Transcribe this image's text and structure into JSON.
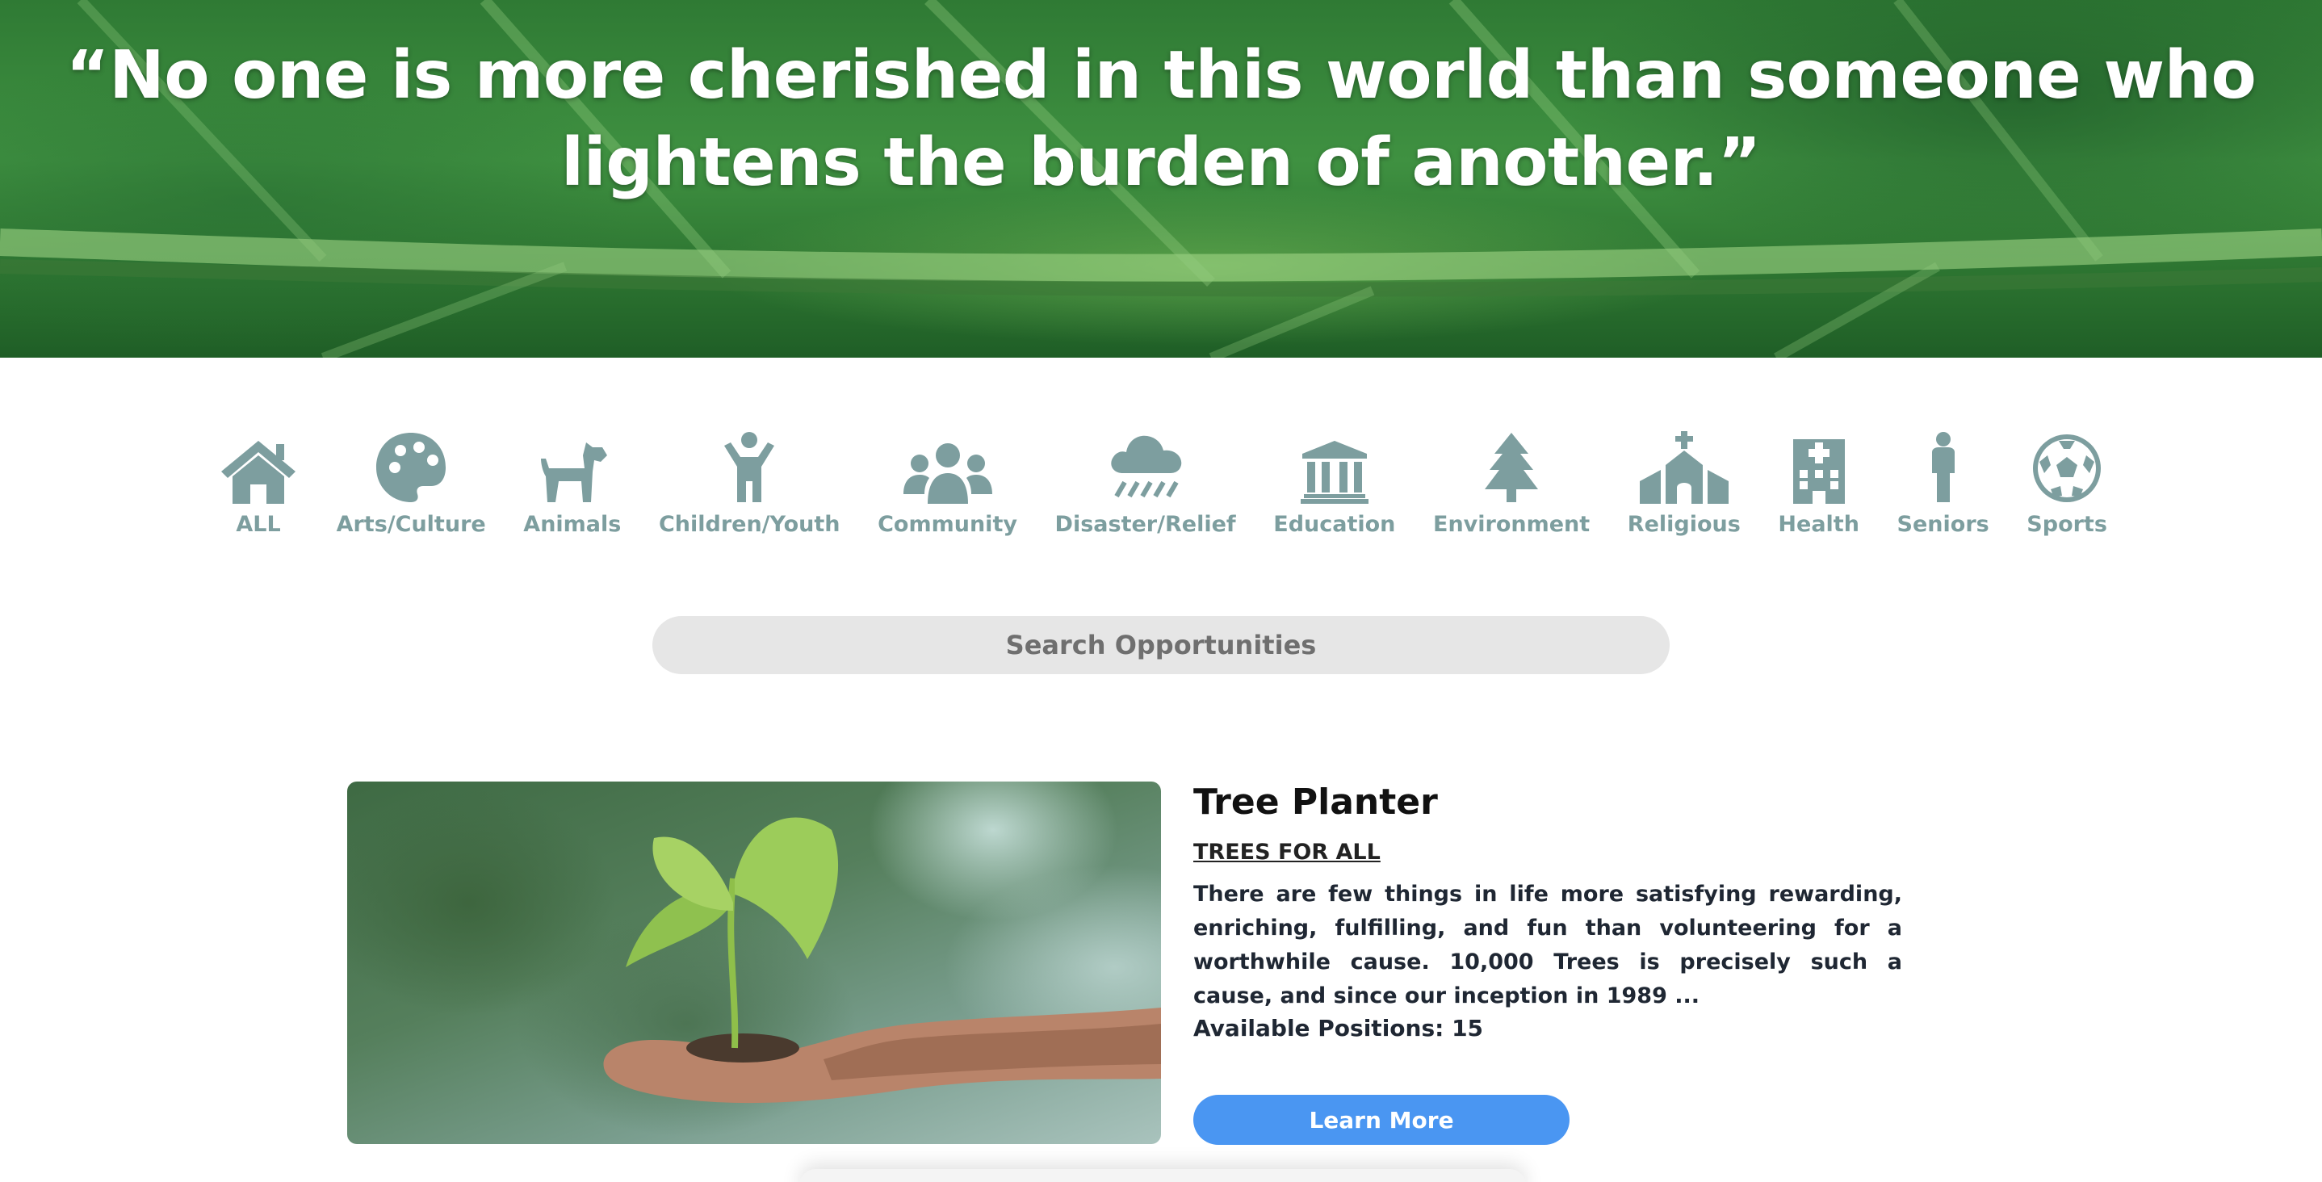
{
  "hero": {
    "quote": "“No one is more cherished in this world than someone who lightens the burden of another.”"
  },
  "categories": [
    {
      "label": "ALL",
      "icon": "home-icon"
    },
    {
      "label": "Arts/Culture",
      "icon": "palette-icon"
    },
    {
      "label": "Animals",
      "icon": "dog-icon"
    },
    {
      "label": "Children/Youth",
      "icon": "child-icon"
    },
    {
      "label": "Community",
      "icon": "people-icon"
    },
    {
      "label": "Disaster/Relief",
      "icon": "storm-cloud-icon"
    },
    {
      "label": "Education",
      "icon": "institution-icon"
    },
    {
      "label": "Environment",
      "icon": "tree-icon"
    },
    {
      "label": "Religious",
      "icon": "church-icon"
    },
    {
      "label": "Health",
      "icon": "hospital-icon"
    },
    {
      "label": "Seniors",
      "icon": "person-icon"
    },
    {
      "label": "Sports",
      "icon": "soccer-ball-icon"
    }
  ],
  "search": {
    "placeholder": "Search Opportunities"
  },
  "opportunity": {
    "title": "Tree Planter",
    "organization": "TREES FOR ALL",
    "description": "There are few things in life more satisfying rewarding, enriching, fulfilling, and fun than volunteering for a worthwhile cause. 10,000 Trees is precisely such a cause, and since our inception in 1989 ...",
    "positions": "Available Positions: 15",
    "button_label": "Learn More"
  },
  "colors": {
    "category_icon": "#7d9e9f",
    "button": "#4a96f2",
    "search_bg": "#e6e6e6"
  }
}
